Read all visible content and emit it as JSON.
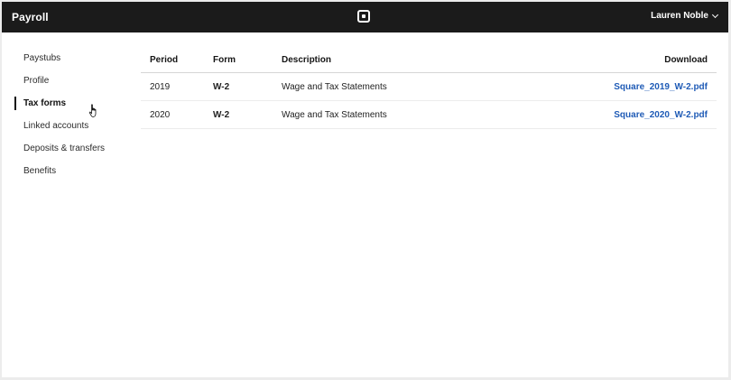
{
  "header": {
    "app_title": "Payroll",
    "logo_icon": "square-logo-icon",
    "user_name": "Lauren Noble"
  },
  "sidebar": {
    "items": [
      {
        "label": "Paystubs",
        "active": false
      },
      {
        "label": "Profile",
        "active": false
      },
      {
        "label": "Tax forms",
        "active": true
      },
      {
        "label": "Linked accounts",
        "active": false
      },
      {
        "label": "Deposits & transfers",
        "active": false
      },
      {
        "label": "Benefits",
        "active": false
      }
    ]
  },
  "table": {
    "columns": [
      "Period",
      "Form",
      "Description",
      "Download"
    ],
    "rows": [
      {
        "period": "2019",
        "form": "W-2",
        "description": "Wage and Tax Statements",
        "download": "Square_2019_W-2.pdf"
      },
      {
        "period": "2020",
        "form": "W-2",
        "description": "Wage and Tax Statements",
        "download": "Square_2020_W-2.pdf"
      }
    ]
  },
  "colors": {
    "topbar": "#1b1b1b",
    "link": "#1f5bb6",
    "background": "#ffffff"
  }
}
